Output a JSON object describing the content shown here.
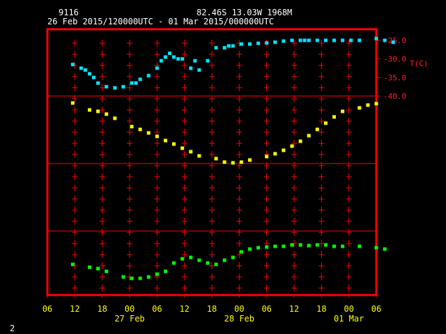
{
  "header": {
    "station_id": "9116",
    "location": "82.46S   13.03W   1968M",
    "period": "26 Feb 2015/120000UTC - 01 Mar 2015/000000UTC"
  },
  "footer": {
    "page_number": "2"
  },
  "colors": {
    "frame": "#ff0000",
    "axis_text": "#ffff00",
    "label_text": "#ff2020",
    "header_text": "#ffffff",
    "temperature": "#00e5ff",
    "pressure": "#ffff00",
    "wind": "#ffff00",
    "rh": "#00ff00"
  },
  "chart_data": {
    "type": "scatter",
    "x_unit": "hours since 26 Feb 2015 06 UTC",
    "x_range": [
      0,
      42
    ],
    "x_ticks": [
      "06",
      "12",
      "18",
      "00",
      "06",
      "12",
      "18",
      "00",
      "06",
      "12",
      "18",
      "00",
      "06"
    ],
    "x_day_labels": [
      {
        "label": "27 Feb",
        "at_tick": 3
      },
      {
        "label": "28 Feb",
        "at_tick": 7
      },
      {
        "label": "01 Mar",
        "at_tick": 11
      }
    ],
    "panels": [
      {
        "name": "temperature",
        "label": "T(C)",
        "tick_values": [
          -25.0,
          -30.0,
          -35.0,
          -40.0
        ],
        "tick_labels": [
          "-25.0",
          "-30.0",
          "-35.0",
          "-40.0"
        ],
        "ylim": [
          -40.0,
          -22.0
        ],
        "x": [
          6,
          8,
          9,
          10,
          11,
          12,
          14,
          16,
          18,
          20,
          21,
          22,
          24,
          26,
          27,
          28,
          29,
          30,
          31,
          32,
          34,
          35,
          36,
          38,
          40,
          42,
          43,
          44,
          46,
          48,
          50,
          52,
          54,
          56,
          58,
          60,
          61,
          62,
          64,
          66,
          68,
          70,
          72,
          74,
          78,
          80,
          82
        ],
        "y": [
          -31.5,
          -32.5,
          -33.0,
          -34.0,
          -35.0,
          -36.5,
          -37.5,
          -37.8,
          -37.5,
          -36.5,
          -36.5,
          -35.5,
          -34.5,
          -32.5,
          -30.5,
          -29.5,
          -28.5,
          -29.5,
          -30.0,
          -30.0,
          -32.5,
          -30.5,
          -33.0,
          -30.5,
          -27.0,
          -27.0,
          -26.5,
          -26.5,
          -26.0,
          -26.0,
          -25.8,
          -25.7,
          -25.5,
          -25.2,
          -25.0,
          -25.0,
          -25.0,
          -25.0,
          -25.0,
          -25.0,
          -25.0,
          -25.0,
          -25.0,
          -25.0,
          -24.5,
          -25.0,
          -25.5
        ]
      }
    ]
  }
}
